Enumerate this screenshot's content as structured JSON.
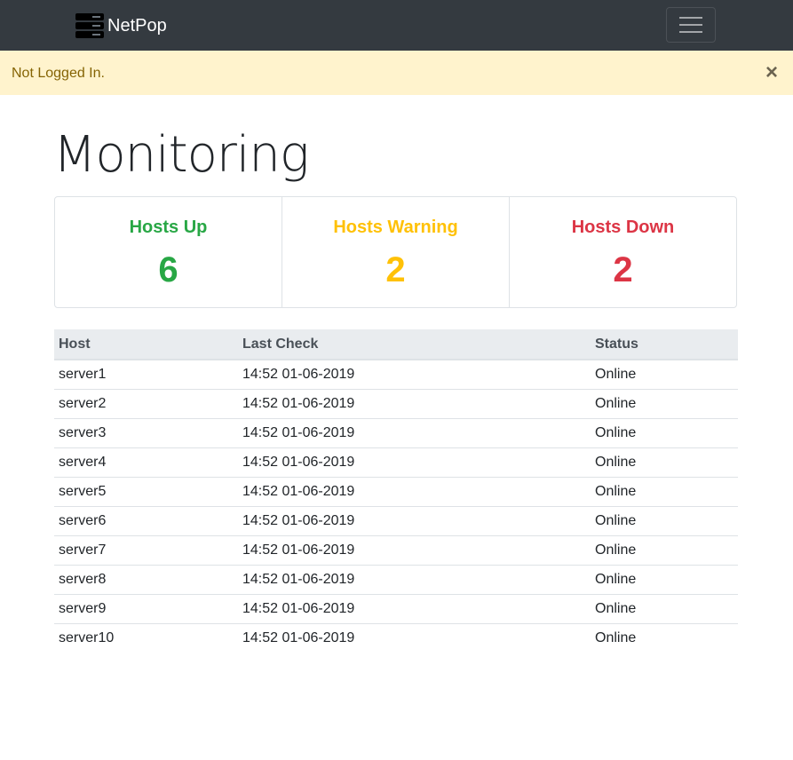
{
  "navbar": {
    "brand": "NetPop",
    "brand_icon": "server-icon",
    "toggle_icon": "hamburger-menu-icon"
  },
  "alert": {
    "message": "Not Logged In.",
    "close_label": "×"
  },
  "page": {
    "title": "Monitoring"
  },
  "summary": {
    "up": {
      "label": "Hosts Up",
      "value": "6",
      "color": "#28a745"
    },
    "warning": {
      "label": "Hosts Warning",
      "value": "2",
      "color": "#ffc107"
    },
    "down": {
      "label": "Hosts Down",
      "value": "2",
      "color": "#dc3545"
    }
  },
  "table": {
    "headers": [
      "Host",
      "Last Check",
      "Status"
    ],
    "rows": [
      [
        "server1",
        "14:52 01-06-2019",
        "Online"
      ],
      [
        "server2",
        "14:52 01-06-2019",
        "Online"
      ],
      [
        "server3",
        "14:52 01-06-2019",
        "Online"
      ],
      [
        "server4",
        "14:52 01-06-2019",
        "Online"
      ],
      [
        "server5",
        "14:52 01-06-2019",
        "Online"
      ],
      [
        "server6",
        "14:52 01-06-2019",
        "Online"
      ],
      [
        "server7",
        "14:52 01-06-2019",
        "Online"
      ],
      [
        "server8",
        "14:52 01-06-2019",
        "Online"
      ],
      [
        "server9",
        "14:52 01-06-2019",
        "Online"
      ],
      [
        "server10",
        "14:52 01-06-2019",
        "Online"
      ]
    ]
  }
}
